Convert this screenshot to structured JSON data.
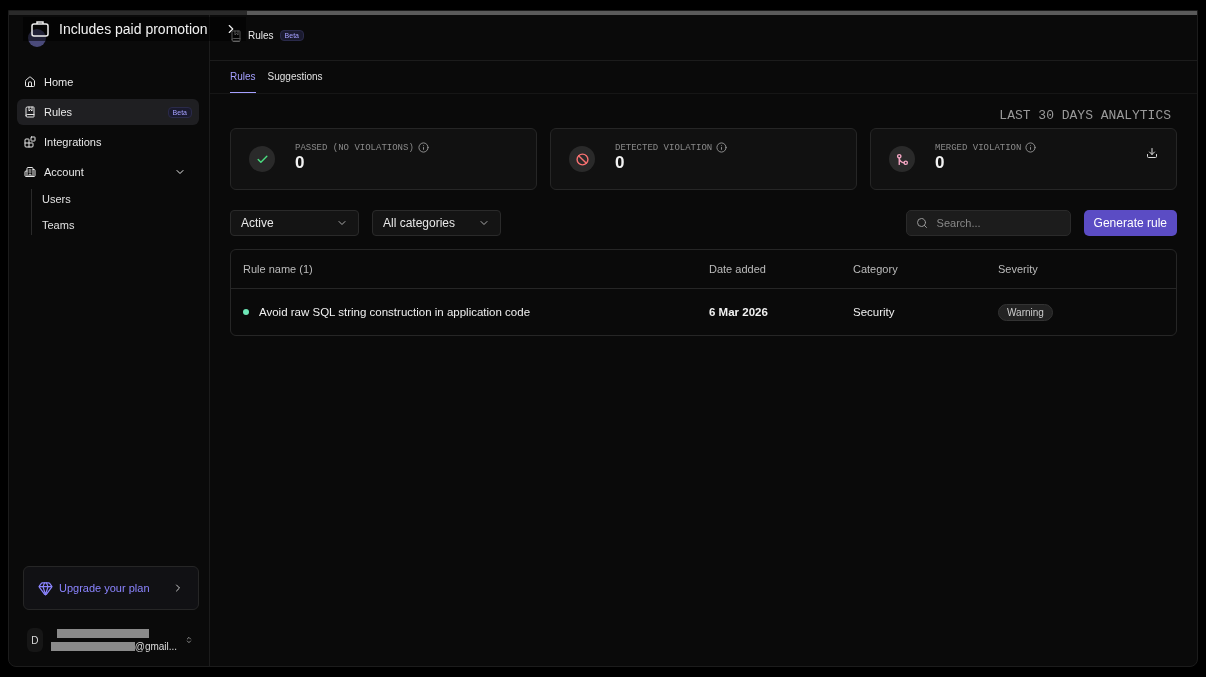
{
  "video_overlay": {
    "promotion_label": "Includes paid promotion",
    "progress": {
      "level": 0.2
    }
  },
  "breadcrumb": {
    "label": "Rules",
    "badge": "Beta"
  },
  "sidebar": {
    "items": [
      {
        "label": "Home",
        "selected": false
      },
      {
        "label": "Rules",
        "selected": true,
        "badge": "Beta"
      },
      {
        "label": "Integrations",
        "selected": false
      },
      {
        "label": "Account",
        "selected": false,
        "expanded": true,
        "children": [
          {
            "label": "Users"
          },
          {
            "label": "Teams"
          }
        ]
      }
    ],
    "upgrade": "Upgrade your plan",
    "user": {
      "initial": "D",
      "email_suffix": "@gmail..."
    }
  },
  "tabs": [
    {
      "label": "Rules",
      "selected": true
    },
    {
      "label": "Suggestions",
      "selected": false
    }
  ],
  "analytics_title": "LAST 30 DAYS ANALYTICS",
  "stats": [
    {
      "kind": "passed",
      "label": "PASSED (NO VIOLATIONS)",
      "value": "0",
      "color": "#4ade80"
    },
    {
      "kind": "detected",
      "label": "DETECTED VIOLATION",
      "value": "0",
      "color": "#f87171"
    },
    {
      "kind": "merged",
      "label": "MERGED VIOLATION",
      "value": "0",
      "color": "#f0a3c0",
      "download": true
    }
  ],
  "filters": [
    {
      "label": "Active"
    },
    {
      "label": "All categories"
    }
  ],
  "search": {
    "placeholder": "Search..."
  },
  "generate_button": "Generate rule",
  "table": {
    "columns": [
      "Rule name (1)",
      "Date added",
      "Category",
      "Severity"
    ],
    "rows": [
      {
        "name": "Avoid raw SQL string construction in application code",
        "date": "6 Mar 2026",
        "category": "Security",
        "severity": "Warning",
        "color": "#6ee7b7"
      }
    ]
  }
}
